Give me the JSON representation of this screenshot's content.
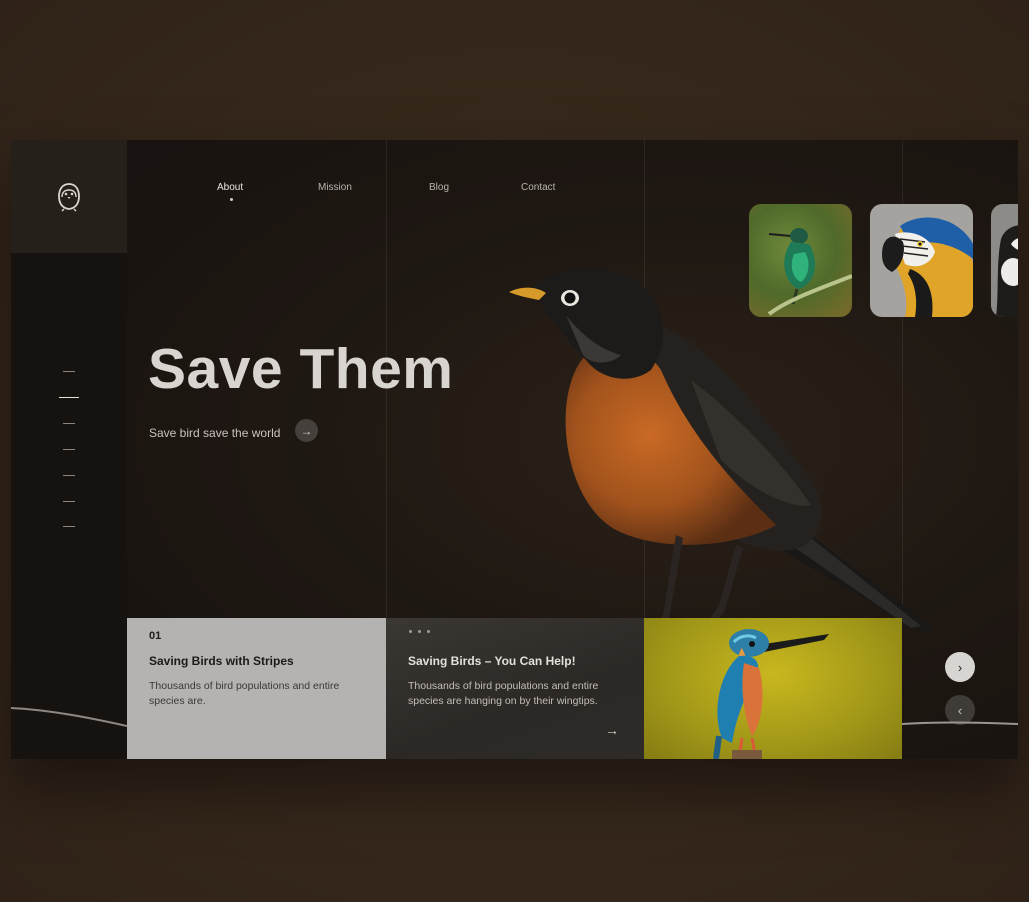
{
  "nav": {
    "items": [
      {
        "label": "About",
        "active": true
      },
      {
        "label": "Mission",
        "active": false
      },
      {
        "label": "Blog",
        "active": false
      },
      {
        "label": "Contact",
        "active": false
      }
    ]
  },
  "hero": {
    "title": "Save Them",
    "subtitle": "Save bird save the world",
    "cta_icon": "arrow-right-icon"
  },
  "gallery": {
    "thumbnails": [
      {
        "icon": "hummingbird-image"
      },
      {
        "icon": "macaw-image"
      },
      {
        "icon": "puffin-image"
      }
    ]
  },
  "cards": [
    {
      "number": "01",
      "title": "Saving Birds with Stripes",
      "text": "Thousands of bird populations and entire species are."
    },
    {
      "title": "Saving Birds – You Can Help!",
      "text": "Thousands of bird populations and entire species are hanging on by their wingtips.",
      "arrow": "→"
    },
    {
      "image": "kingfisher-image"
    }
  ],
  "controls": {
    "next": "›",
    "prev": "‹"
  },
  "colors": {
    "page_bg": "#3a2b1e",
    "frame_bg": "#1b1511",
    "robin_breast": "#b35a1f",
    "card_light": "#b4b3b1",
    "card_yellow": "#b5a81c"
  }
}
